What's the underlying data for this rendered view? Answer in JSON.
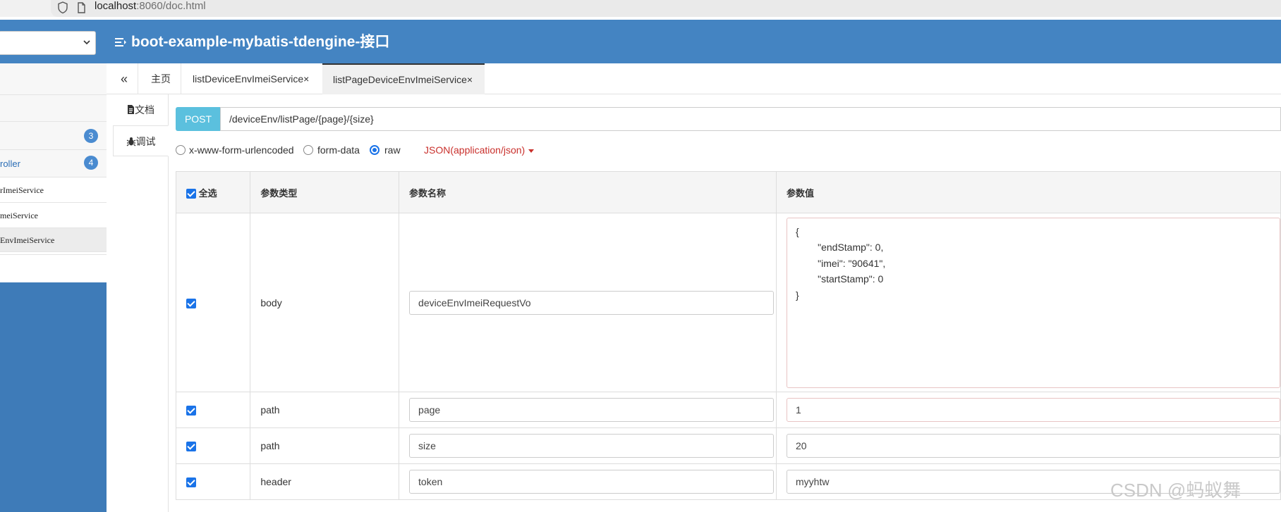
{
  "browser": {
    "url_host": "localhost",
    "url_rest": ":8060/doc.html"
  },
  "header": {
    "title": "boot-example-mybatis-tdengine-接口"
  },
  "sidebar": {
    "items": [
      {
        "label": "",
        "badge": "3"
      },
      {
        "label": "roller",
        "badge": "4"
      },
      {
        "label": "rImeiService"
      },
      {
        "label": "meiService"
      },
      {
        "label": "EnvImeiService"
      }
    ]
  },
  "tabs": {
    "collapse_glyph": "«",
    "items": [
      {
        "label": "主页"
      },
      {
        "label": "listDeviceEnvImeiService",
        "close": "×"
      },
      {
        "label": "listPageDeviceEnvImeiService",
        "close": "×"
      }
    ]
  },
  "side_tabs": {
    "doc": "文档",
    "debug": "调试"
  },
  "request": {
    "method": "POST",
    "url": "/deviceEnv/listPage/{page}/{size}"
  },
  "body_type": {
    "options": [
      "x-www-form-urlencoded",
      "form-data",
      "raw"
    ],
    "selected": "raw",
    "content_type": "JSON(application/json)"
  },
  "params_table": {
    "headers": {
      "select_all": "全选",
      "type": "参数类型",
      "name": "参数名称",
      "value": "参数值"
    },
    "rows": [
      {
        "type": "body",
        "name": "deviceEnvImeiRequestVo",
        "value": "{\n        \"endStamp\": 0,\n        \"imei\": \"90641\",\n        \"startStamp\": 0\n}"
      },
      {
        "type": "path",
        "name": "page",
        "value": "1"
      },
      {
        "type": "path",
        "name": "size",
        "value": "20"
      },
      {
        "type": "header",
        "name": "token",
        "value": "myyhtw"
      }
    ]
  },
  "watermark": "CSDN @蚂蚁舞",
  "colors": {
    "header_bg": "#4484c2",
    "method_bg": "#5bc0de",
    "content_type": "#c9302c",
    "sidebar_blue": "#3e7bb8"
  }
}
